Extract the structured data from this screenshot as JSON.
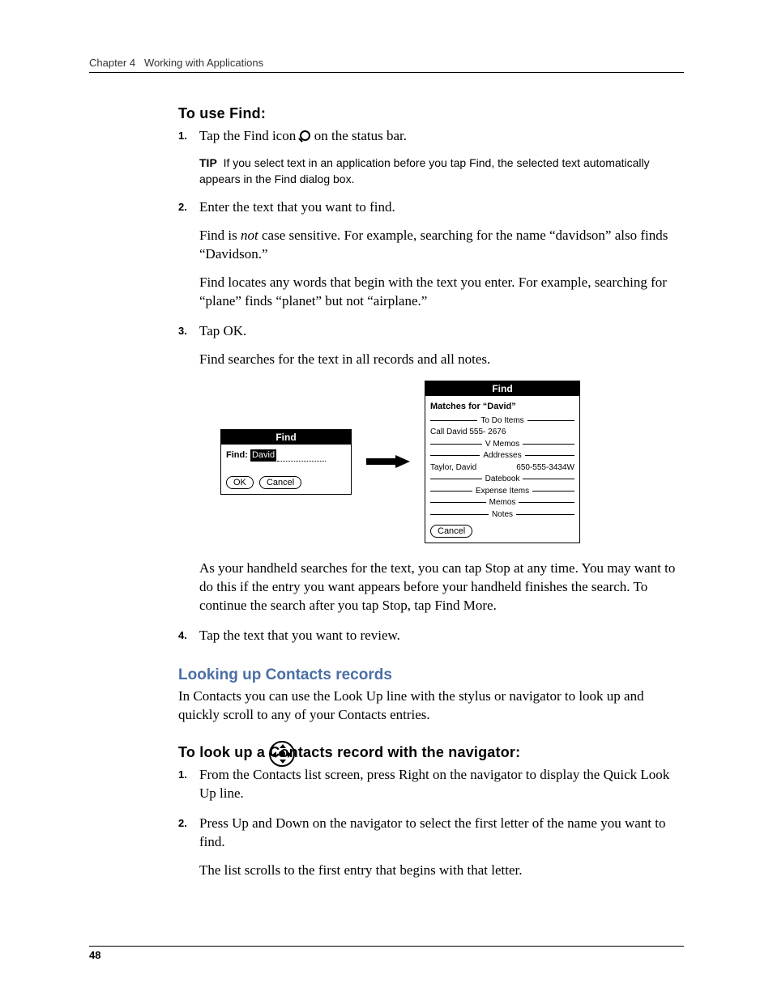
{
  "header": {
    "chapter": "Chapter 4",
    "title": "Working with Applications"
  },
  "sectionA": {
    "heading": "To use Find:",
    "step1a": "Tap the Find icon ",
    "step1b": " on the status bar.",
    "tipLabel": "TIP",
    "tipText": "If you select text in an application before you tap Find, the selected text automatically appears in the Find dialog box.",
    "step2": "Enter the text that you want to find.",
    "step2p1a": "Find is ",
    "step2p1_not": "not",
    "step2p1b": " case sensitive. For example, searching for the name “davidson” also finds “Davidson.”",
    "step2p2": "Find locates any words that begin with the text you enter. For example, searching for “plane” finds “planet” but not “airplane.”",
    "step3": "Tap OK.",
    "step3p1": "Find searches for the text in all records and all notes.",
    "step3p2": "As your handheld searches for the text, you can tap Stop at any time. You may want to do this if the entry you want appears before your handheld finishes the search. To continue the search after you tap Stop, tap Find More.",
    "step4": "Tap the text that you want to review."
  },
  "fig": {
    "dlg1": {
      "title": "Find",
      "label": "Find:",
      "value": "David",
      "ok": "OK",
      "cancel": "Cancel"
    },
    "dlg2": {
      "title": "Find",
      "matches": "Matches for “David”",
      "groups": {
        "todo": "To Do Items",
        "todo_entry": "Call David 555- 2676",
        "vmemos": "V Memos",
        "addresses": "Addresses",
        "addr_entry_name": "Taylor, David",
        "addr_entry_phone": "650-555-3434W",
        "datebook": "Datebook",
        "expense": "Expense Items",
        "memos": "Memos",
        "notes": "Notes"
      },
      "cancel": "Cancel"
    }
  },
  "sectionB": {
    "heading": "Looking up Contacts records",
    "intro": "In Contacts you can use the Look Up line with the stylus or navigator to look up and quickly scroll to any of your Contacts entries.",
    "subheading": "To look up a Contacts record with the navigator:",
    "step1": "From the Contacts list screen, press Right on the navigator to display the Quick Look Up line.",
    "step2": "Press Up and Down on the navigator to select the first letter of the name you want to find.",
    "step2p1": "The list scrolls to the first entry that begins with that letter."
  },
  "pageNumber": "48"
}
